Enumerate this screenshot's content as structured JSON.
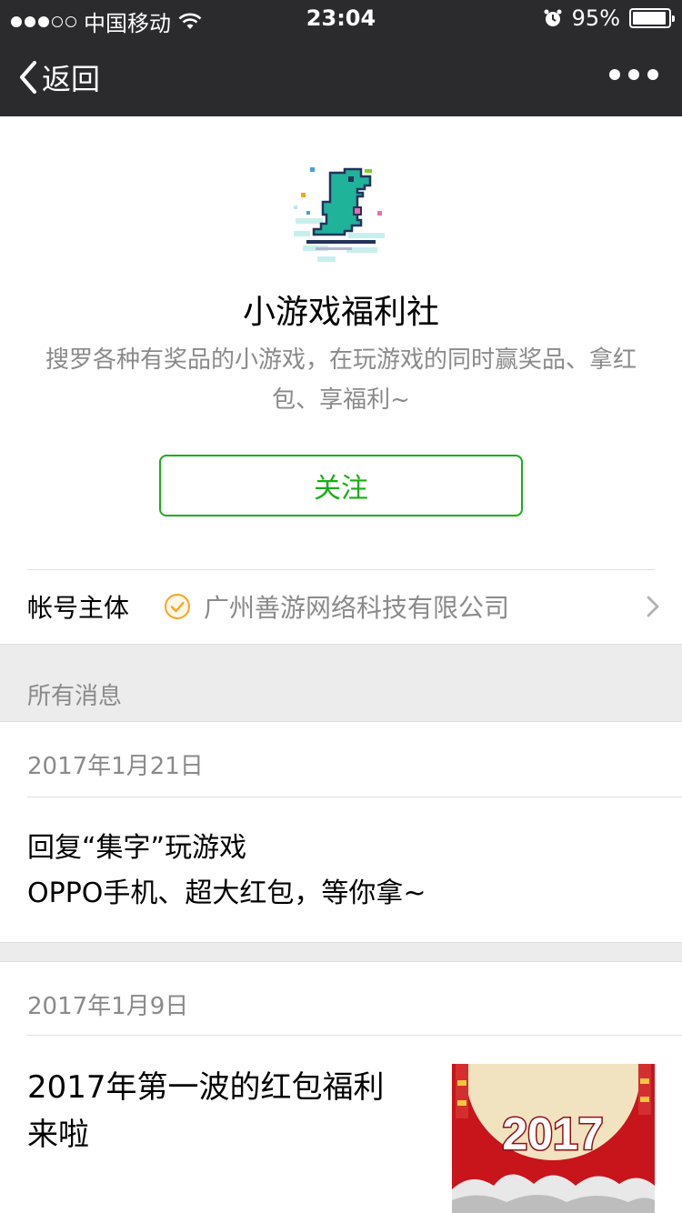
{
  "status_bar": {
    "carrier": "中国移动",
    "time": "23:04",
    "battery": "95%",
    "battery_level": 0.95,
    "signal_bars": 3,
    "signal_total": 5
  },
  "nav": {
    "back_label": "返回"
  },
  "profile": {
    "name": "小游戏福利社",
    "description": "搜罗各种有奖品的小游戏，在玩游戏的同时赢奖品、拿红包、享福利~",
    "follow_label": "关注"
  },
  "account": {
    "label": "帐号主体",
    "company": "广州善游网络科技有限公司"
  },
  "messages": {
    "section_title": "所有消息",
    "items": [
      {
        "date": "2017年1月21日",
        "line1": "回复“集字”玩游戏",
        "line2": "OPPO手机、超大红包，等你拿~"
      },
      {
        "date": "2017年1月9日",
        "title": "2017年第一波的红包福利来啦",
        "thumb_text": "2017"
      }
    ]
  },
  "colors": {
    "nav_bg": "#2b2b2d",
    "accent_green": "#1aad19",
    "verify_orange": "#f5a623",
    "muted_text": "#8a8a8a",
    "band_bg": "#ececec"
  }
}
